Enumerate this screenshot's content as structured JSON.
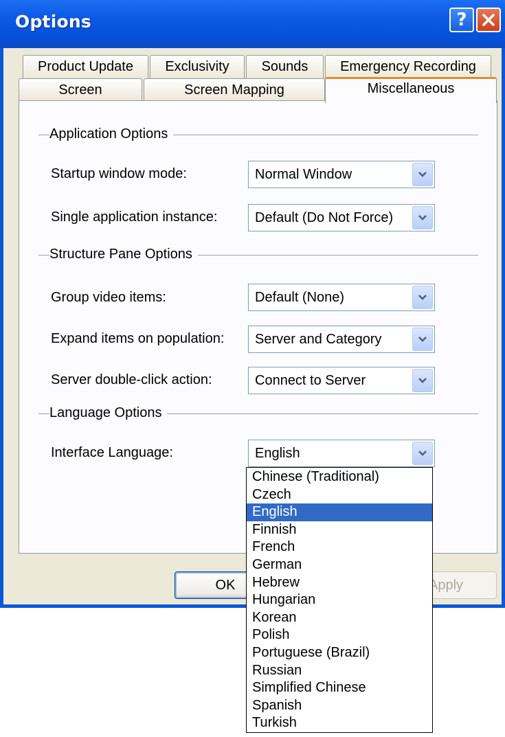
{
  "window": {
    "title": "Options",
    "help_label": "?"
  },
  "tabs": {
    "row1": [
      "Product Update",
      "Exclusivity",
      "Sounds",
      "Emergency Recording"
    ],
    "row2": [
      "Screen",
      "Screen Mapping",
      "Miscellaneous"
    ],
    "active": "Miscellaneous"
  },
  "application_options": {
    "title": "Application Options",
    "startup_label": "Startup window mode:",
    "startup_value": "Normal Window",
    "single_label": "Single application instance:",
    "single_value": "Default (Do Not Force)"
  },
  "structure_pane_options": {
    "title": "Structure Pane Options",
    "group_label": "Group video items:",
    "group_value": "Default (None)",
    "expand_label": "Expand items on population:",
    "expand_value": "Server and Category",
    "dblclick_label": "Server double-click action:",
    "dblclick_value": "Connect to Server"
  },
  "language_options": {
    "title": "Language Options",
    "language_label": "Interface Language:",
    "language_value": "English",
    "options": [
      "Chinese (Traditional)",
      "Czech",
      "English",
      "Finnish",
      "French",
      "German",
      "Hebrew",
      "Hungarian",
      "Korean",
      "Polish",
      "Portuguese (Brazil)",
      "Russian",
      "Simplified Chinese",
      "Spanish",
      "Turkish"
    ],
    "selected_option": "English"
  },
  "buttons": {
    "ok": "OK",
    "apply": "Apply"
  },
  "colors": {
    "title_bar": "#0a58d8",
    "active_tab_accent": "#e68b2c",
    "selection": "#316ac5"
  }
}
